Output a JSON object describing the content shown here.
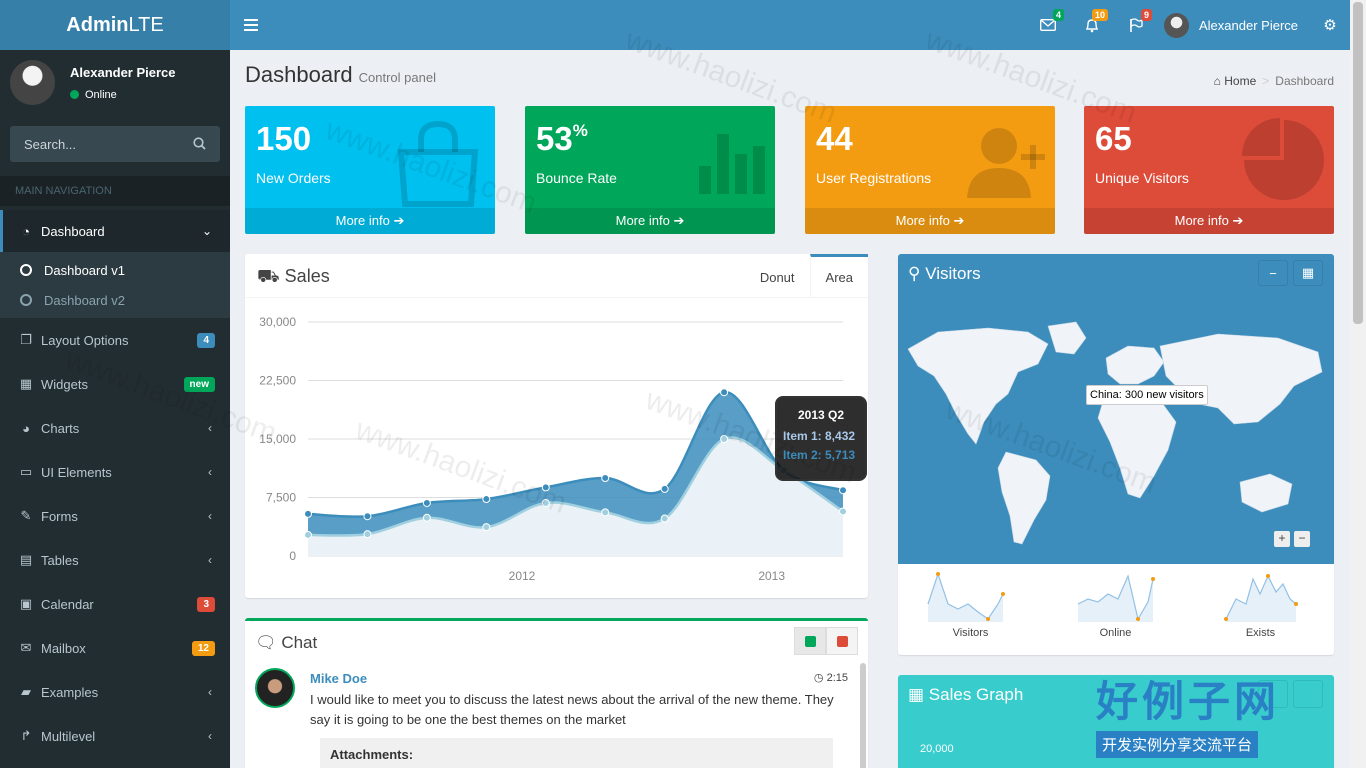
{
  "header": {
    "logo_bold": "Admin",
    "logo_rest": "LTE",
    "messages_count": "4",
    "notifications_count": "10",
    "tasks_count": "9",
    "user_name": "Alexander Pierce"
  },
  "sidebar": {
    "user_name": "Alexander Pierce",
    "status": "Online",
    "search_placeholder": "Search...",
    "nav_header": "MAIN NAVIGATION",
    "items": [
      {
        "label": "Dashboard",
        "icon": "dashboard-icon"
      },
      {
        "label": "Layout Options",
        "badge": "4",
        "badge_color": "#3c8dbc"
      },
      {
        "label": "Widgets",
        "badge": "new",
        "badge_color": "#00a65a"
      },
      {
        "label": "Charts"
      },
      {
        "label": "UI Elements"
      },
      {
        "label": "Forms"
      },
      {
        "label": "Tables"
      },
      {
        "label": "Calendar",
        "badge": "3",
        "badge_color": "#dd4b39"
      },
      {
        "label": "Mailbox",
        "badge": "12",
        "badge_color": "#f39c12"
      },
      {
        "label": "Examples"
      },
      {
        "label": "Multilevel"
      }
    ],
    "sub_items": [
      {
        "label": "Dashboard v1"
      },
      {
        "label": "Dashboard v2"
      }
    ]
  },
  "content": {
    "title": "Dashboard",
    "subtitle": "Control panel",
    "breadcrumb_home": "Home",
    "breadcrumb_current": "Dashboard"
  },
  "stats": [
    {
      "value": "150",
      "suffix": "",
      "label": "New Orders",
      "more": "More info",
      "color": "#00c0ef"
    },
    {
      "value": "53",
      "suffix": "%",
      "label": "Bounce Rate",
      "more": "More info",
      "color": "#00a65a"
    },
    {
      "value": "44",
      "suffix": "",
      "label": "User Registrations",
      "more": "More info",
      "color": "#f39c12"
    },
    {
      "value": "65",
      "suffix": "",
      "label": "Unique Visitors",
      "more": "More info",
      "color": "#dd4b39"
    }
  ],
  "sales": {
    "title": "Sales",
    "tab_donut": "Donut",
    "tab_area": "Area",
    "tooltip_title": "2013 Q2",
    "tooltip_item1": "Item 1: 8,432",
    "tooltip_item2": "Item 2: 5,713"
  },
  "chart_data": {
    "type": "area",
    "ylim": [
      0,
      30000
    ],
    "yticks": [
      "30,000",
      "22,500",
      "15,000",
      "7,500",
      "0"
    ],
    "xticks": [
      "2012",
      "2013"
    ],
    "x": [
      "2011 Q1",
      "2011 Q2",
      "2011 Q3",
      "2011 Q4",
      "2012 Q1",
      "2012 Q2",
      "2012 Q3",
      "2012 Q4",
      "2013 Q1",
      "2013 Q2"
    ],
    "series": [
      {
        "name": "Item 1",
        "values": [
          5400,
          5100,
          6800,
          7300,
          8800,
          10000,
          8600,
          21000,
          11000,
          8432
        ]
      },
      {
        "name": "Item 2",
        "values": [
          2700,
          2800,
          4900,
          3700,
          6800,
          5600,
          4800,
          15000,
          11000,
          5713
        ]
      }
    ]
  },
  "chat": {
    "title": "Chat",
    "name": "Mike Doe",
    "time": "2:15",
    "message": "I would like to meet you to discuss the latest news about the arrival of the new theme. They say it is going to be one the best themes on the market",
    "attachments": "Attachments:"
  },
  "visitors": {
    "title": "Visitors",
    "map_tooltip": "China: 300 new visitors",
    "zoom_in": "+",
    "zoom_out": "−",
    "sparks": [
      {
        "label": "Visitors"
      },
      {
        "label": "Online"
      },
      {
        "label": "Exists"
      }
    ]
  },
  "sales_graph": {
    "title": "Sales Graph",
    "tick": "20,000"
  },
  "watermark": {
    "text": "www.haolizi.com",
    "brand": "好例子网",
    "brand_sub": "开发实例分享交流平台"
  }
}
